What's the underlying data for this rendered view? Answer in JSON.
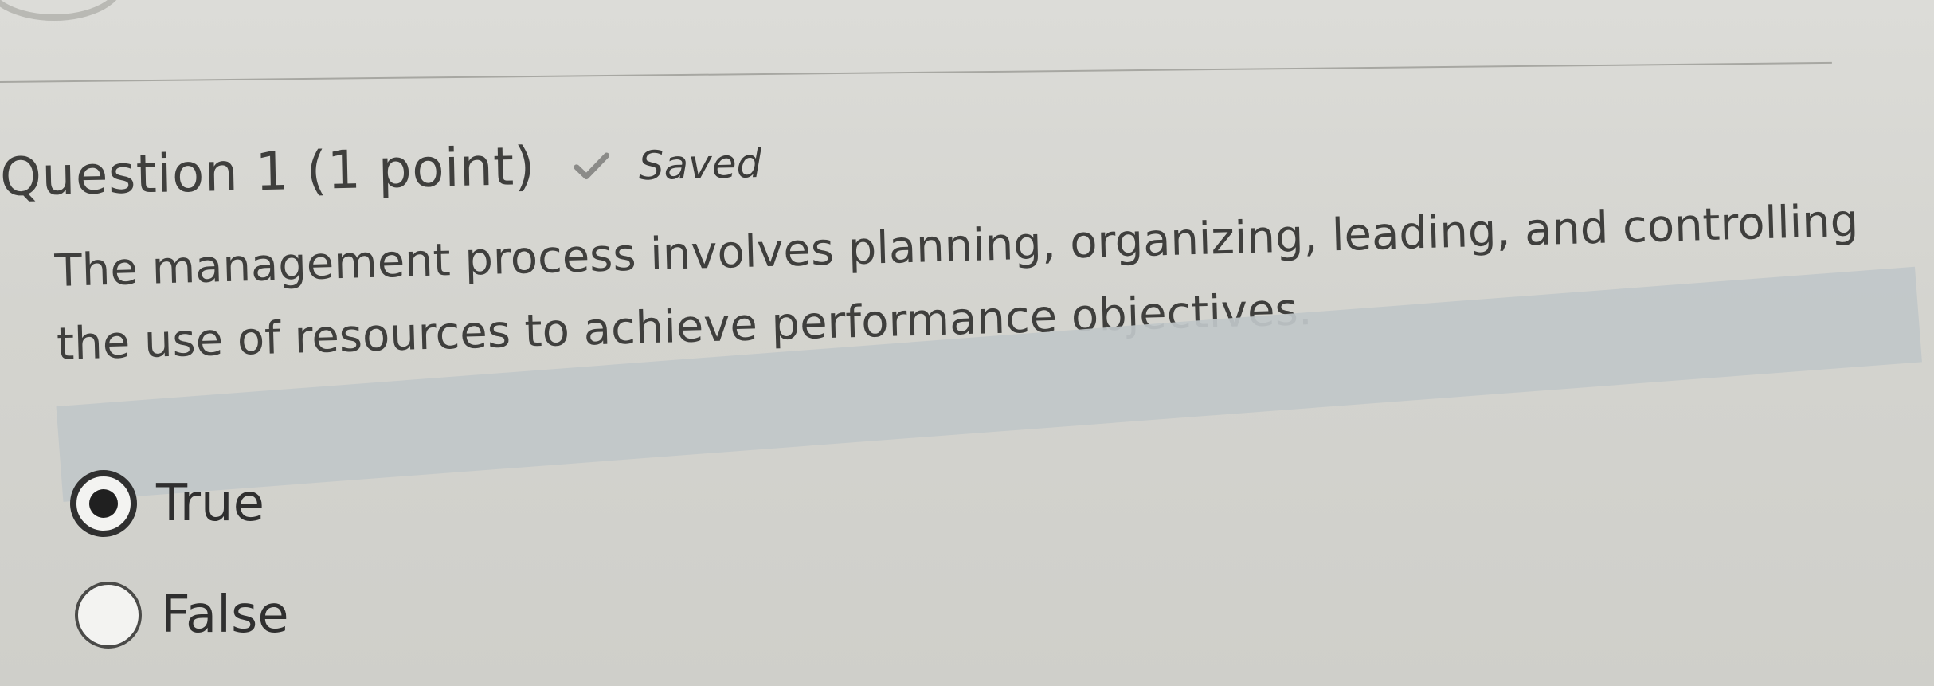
{
  "question": {
    "title": "Question 1 (1 point)",
    "status": "Saved",
    "text": "The management process involves planning, organizing, leading, and controlling the use of resources to achieve performance objectives."
  },
  "answers": {
    "options": [
      {
        "label": "True",
        "selected": true
      },
      {
        "label": "False",
        "selected": false
      }
    ]
  },
  "icons": {
    "saved": "check-icon",
    "selected_radio": "radio-selected-icon",
    "unselected_radio": "radio-unselected-icon"
  },
  "colors": {
    "background": "#d4d4cf",
    "text": "#3f3f3d",
    "selected_highlight": "#c0c7c9",
    "radio_fill": "#f3f3f1"
  }
}
